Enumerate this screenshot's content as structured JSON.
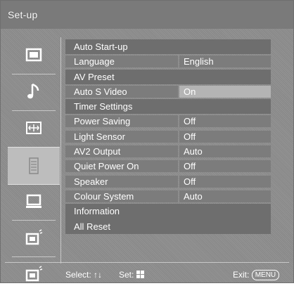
{
  "window": {
    "title": "Set-up"
  },
  "sidebar": {
    "items": [
      {
        "icon": "picture-icon"
      },
      {
        "icon": "music-note-icon"
      },
      {
        "icon": "screen-icon"
      },
      {
        "icon": "toolbox-icon",
        "selected": true
      },
      {
        "icon": "monitor-icon"
      },
      {
        "icon": "pc-input-icon"
      },
      {
        "icon": "device-input-icon"
      }
    ]
  },
  "menu": {
    "rows": [
      {
        "label": "Auto Start-up",
        "value": ""
      },
      {
        "label": "Language",
        "value": "English"
      },
      {
        "label": "AV Preset",
        "value": ""
      },
      {
        "label": "Auto S Video",
        "value": "On"
      },
      {
        "label": "Timer Settings",
        "value": ""
      },
      {
        "label": "Power Saving",
        "value": "Off"
      },
      {
        "label": "Light Sensor",
        "value": "Off"
      },
      {
        "label": "AV2 Output",
        "value": "Auto"
      },
      {
        "label": "Quiet Power On",
        "value": "Off"
      },
      {
        "label": "Speaker",
        "value": "Off"
      },
      {
        "label": "Colour System",
        "value": "Auto"
      },
      {
        "label": "Information",
        "value": ""
      },
      {
        "label": "All Reset",
        "value": ""
      }
    ]
  },
  "footer": {
    "select": "Select:",
    "set": "Set:",
    "exit": "Exit:",
    "menu_key": "MENU"
  }
}
